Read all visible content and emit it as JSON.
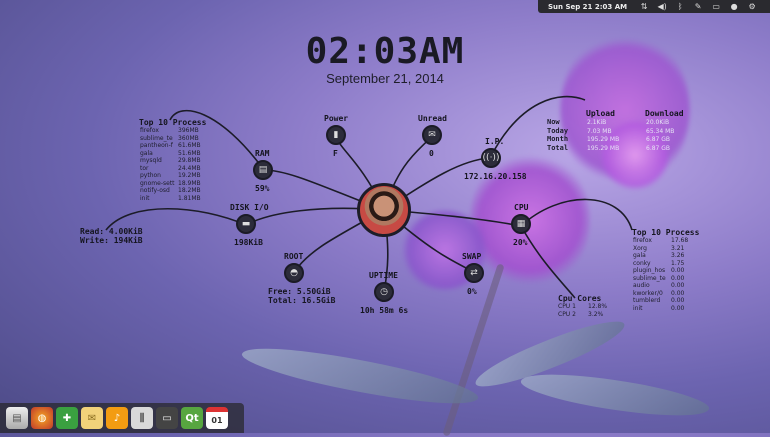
{
  "panel": {
    "clock": "Sun Sep 21  2:03 AM",
    "indicators": [
      "network-icon",
      "volume-icon",
      "bluetooth-icon",
      "pen-icon",
      "battery-icon",
      "user-icon",
      "gear-icon"
    ]
  },
  "clock": {
    "time": "02:03AM",
    "date": "September 21, 2014"
  },
  "nodes": {
    "power": {
      "title": "Power",
      "value": "F"
    },
    "unread": {
      "title": "Unread",
      "value": "0"
    },
    "ram": {
      "title": "RAM",
      "value": "59%"
    },
    "ip": {
      "title": "I.P.",
      "value": "172.16.20.158"
    },
    "disk": {
      "title": "DISK I/O",
      "value": "198KiB"
    },
    "cpu": {
      "title": "CPU",
      "value": "20%"
    },
    "root": {
      "title": "ROOT",
      "free": "Free: 5.50GiB",
      "total": "Total: 16.5GiB"
    },
    "uptime": {
      "title": "UPTIME",
      "value": "10h 58m 6s"
    },
    "swap": {
      "title": "SWAP",
      "value": "0%"
    },
    "cpucores": {
      "title": "Cpu Cores",
      "cores": [
        {
          "name": "CPU 1",
          "value": "12.8%"
        },
        {
          "name": "CPU 2",
          "value": "3.2%"
        }
      ]
    }
  },
  "disk_rw": {
    "read": "Read: 4.00KiB",
    "write": "Write: 194KiB"
  },
  "top_mem": {
    "title": "Top 10 Process",
    "rows": [
      [
        "firefox",
        "396MB"
      ],
      [
        "sublime_te",
        "360MB"
      ],
      [
        "pantheon-f",
        "61.6MB"
      ],
      [
        "gala",
        "51.6MB"
      ],
      [
        "mysqld",
        "29.8MB"
      ],
      [
        "tor",
        "24.4MB"
      ],
      [
        "python",
        "19.2MB"
      ],
      [
        "gnome-sett",
        "18.9MB"
      ],
      [
        "notify-osd",
        "18.2MB"
      ],
      [
        "init",
        "1.81MB"
      ]
    ]
  },
  "top_cpu": {
    "title": "Top 10 Process",
    "rows": [
      [
        "firefox",
        "17.68"
      ],
      [
        "Xorg",
        "3.21"
      ],
      [
        "gala",
        "3.26"
      ],
      [
        "conky",
        "1.75"
      ],
      [
        "plugin_hos",
        "0.00"
      ],
      [
        "sublime_te",
        "0.00"
      ],
      [
        "audio",
        "0.00"
      ],
      [
        "kworker/0",
        "0.00"
      ],
      [
        "tumblerd",
        "0.00"
      ],
      [
        "init",
        "0.00"
      ]
    ]
  },
  "net": {
    "upload_label": "Upload",
    "download_label": "Download",
    "labels": [
      "Now",
      "Today",
      "Month",
      "Total"
    ],
    "upload": [
      "2.1KiB",
      "7.03 MB",
      "195.29 MB",
      "195.29 MB"
    ],
    "download": [
      "20.0KiB",
      "65.34 MB",
      "6.87 GB",
      "6.87 GB"
    ]
  },
  "dock": {
    "apps": [
      "files",
      "firefox",
      "settings",
      "mail",
      "music",
      "sublime",
      "terminal",
      "qt",
      "calendar"
    ],
    "calendar_day": "01"
  }
}
